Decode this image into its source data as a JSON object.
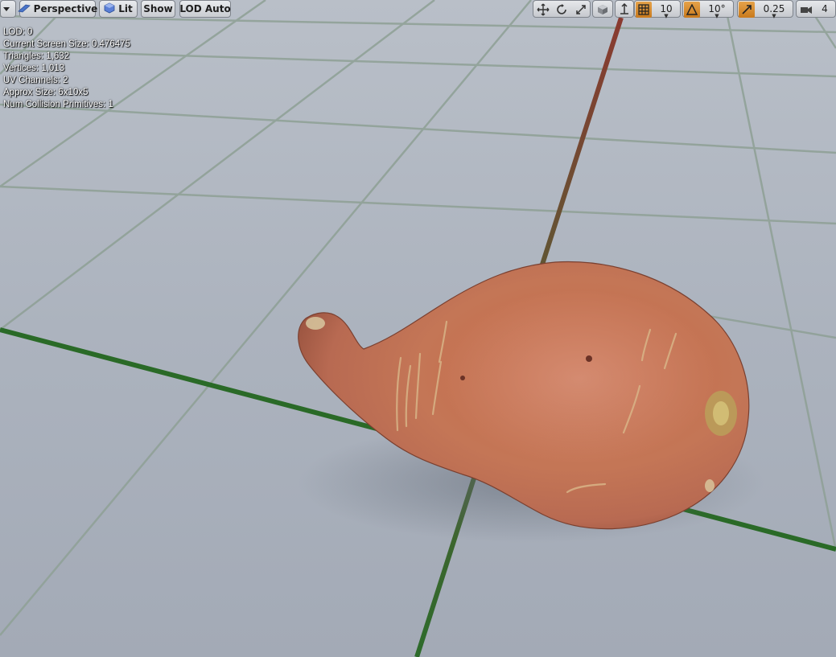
{
  "viewport_options": {
    "label": ""
  },
  "view_mode": {
    "label": "Perspective"
  },
  "lighting": {
    "label": "Lit"
  },
  "show": {
    "label": "Show"
  },
  "lod": {
    "label": "LOD Auto"
  },
  "snapping": {
    "grid_snap_value": "10",
    "rotation_snap_value": "10°",
    "scale_snap_value": "0.25",
    "camera_speed_value": "4"
  },
  "stats": [
    {
      "label": "LOD:",
      "value": "0"
    },
    {
      "label": "Current Screen Size:",
      "value": "0.476475"
    },
    {
      "label": "Triangles:",
      "value": "1,632"
    },
    {
      "label": "Vertices:",
      "value": "1,013"
    },
    {
      "label": "UV Channels:",
      "value": "2"
    },
    {
      "label": "Approx Size:",
      "value": "6x10x5"
    },
    {
      "label": "Num Collision Primitives:",
      "value": "1"
    }
  ],
  "colors": {
    "floor": "#a8b0bc",
    "grid_line": "#7f9b8b",
    "axis_x": "#2c6b2a",
    "axis_y_far": "#7a3a2a",
    "mesh_skin": "#c26a48",
    "toolbar_active": "#d48a2c"
  },
  "icons": [
    "viewport-options-icon",
    "perspective-icon",
    "lit-icon",
    "translate-icon",
    "rotate-icon",
    "scale-icon",
    "world-local-icon",
    "surface-snap-icon",
    "grid-snap-icon",
    "rotation-snap-icon",
    "scale-snap-icon",
    "camera-speed-icon"
  ]
}
